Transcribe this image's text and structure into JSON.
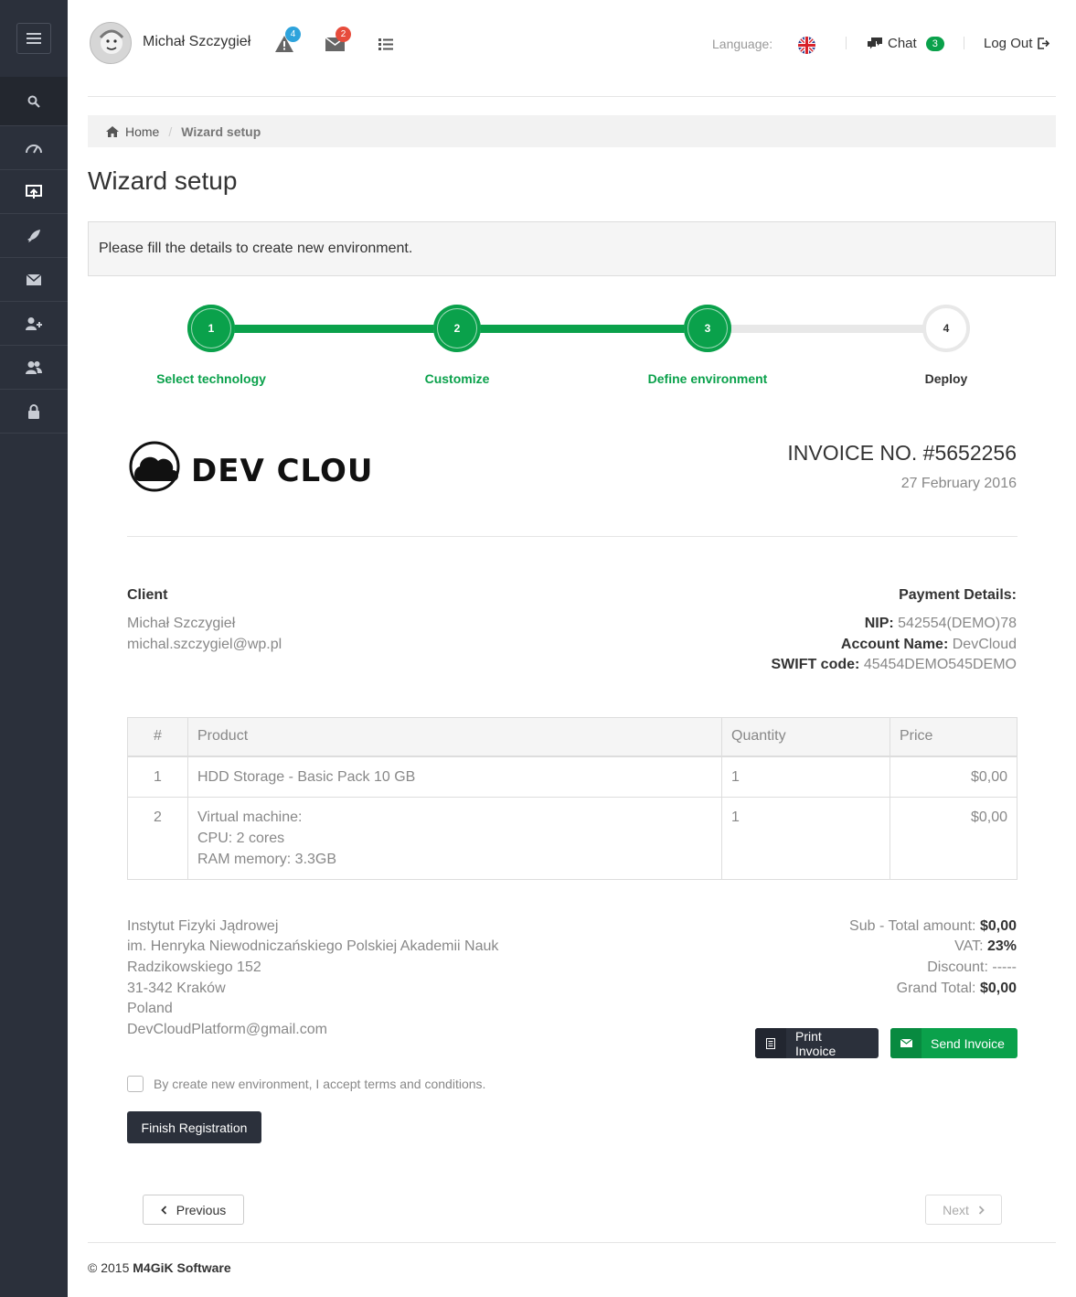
{
  "topbar": {
    "username": "Michał Szczygieł",
    "alerts_count": "4",
    "messages_count": "2",
    "language_label": "Language:",
    "chat_label": "Chat",
    "chat_count": "3",
    "logout_label": "Log Out"
  },
  "sidebar": {
    "items": [
      "menu-icon",
      "search-icon",
      "dashboard-icon",
      "upload-screen-icon",
      "rocket-icon",
      "mail-icon",
      "add-user-icon",
      "users-icon",
      "lock-icon"
    ]
  },
  "breadcrumb": {
    "home": "Home",
    "current": "Wizard setup"
  },
  "page": {
    "title": "Wizard setup",
    "alert": "Please fill the details to create new environment."
  },
  "wizard": {
    "steps": [
      {
        "number": "1",
        "label": "Select technology",
        "status": "done"
      },
      {
        "number": "2",
        "label": "Customize",
        "status": "done"
      },
      {
        "number": "3",
        "label": "Define environment",
        "status": "done"
      },
      {
        "number": "4",
        "label": "Deploy",
        "status": "todo"
      }
    ],
    "accent_color": "#0aa14b"
  },
  "invoice": {
    "logo_text": "DEV CLOUD",
    "number": "INVOICE NO. #5652256",
    "date": "27 February 2016",
    "client": {
      "heading": "Client",
      "name": "Michał Szczygieł",
      "email": "michal.szczygiel@wp.pl"
    },
    "payment": {
      "heading": "Payment Details:",
      "nip_label": "NIP:",
      "nip_value": "542554(DEMO)78",
      "account_label": "Account Name:",
      "account_value": "DevCloud",
      "swift_label": "SWIFT code:",
      "swift_value": "45454DEMO545DEMO"
    },
    "table": {
      "headers": [
        "#",
        "Product",
        "Quantity",
        "Price"
      ],
      "rows": [
        {
          "num": "1",
          "product_lines": [
            "HDD Storage - Basic Pack 10 GB"
          ],
          "quantity": "1",
          "price": "$0,00"
        },
        {
          "num": "2",
          "product_lines": [
            "Virtual machine:",
            "CPU: 2 cores",
            "RAM memory: 3.3GB"
          ],
          "quantity": "1",
          "price": "$0,00"
        }
      ]
    },
    "address": [
      "Instytut Fizyki Jądrowej",
      "im. Henryka Niewodniczańskiego Polskiej Akademii Nauk",
      "Radzikowskiego 152",
      "31-342 Kraków",
      "Poland",
      "DevCloudPlatform@gmail.com"
    ],
    "totals": {
      "subtotal_label": "Sub - Total amount:",
      "subtotal_value": "$0,00",
      "vat_label": "VAT:",
      "vat_value": "23%",
      "discount_label": "Discount:",
      "discount_value": "-----",
      "grand_label": "Grand Total:",
      "grand_value": "$0,00"
    },
    "print_label": "Print Invoice",
    "send_label": "Send Invoice"
  },
  "form": {
    "terms_label": "By create new environment, I accept terms and conditions.",
    "terms_checked": false,
    "finish_label": "Finish Registration"
  },
  "nav": {
    "previous_label": "Previous",
    "next_label": "Next"
  },
  "footer": {
    "copyright": "© 2015",
    "company": "M4GiK Software"
  }
}
